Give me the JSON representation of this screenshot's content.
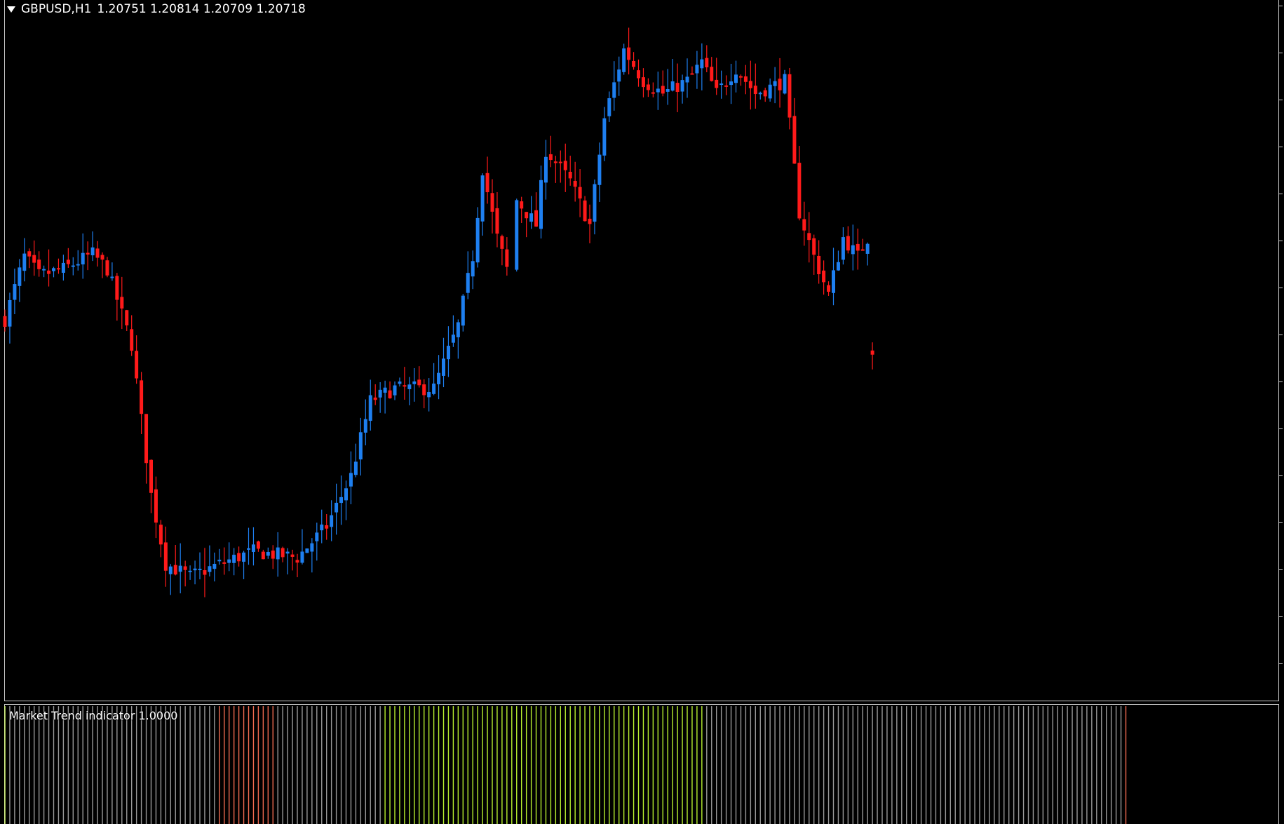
{
  "chart": {
    "symbol_timeframe": "GBPUSD,H1",
    "quote": "1.20751 1.20814 1.20709 1.20718",
    "bull_color": "#1e7ff0",
    "bear_color": "#ff1a1a",
    "background": "#000000"
  },
  "indicator": {
    "label": "Market Trend indicator 1.0000",
    "colors": {
      "neutral": "#9a9a9a",
      "down": "#f06a50",
      "up": "#b8f030",
      "lime": "#d8ff70"
    },
    "bars": "LNNNNNNNNNNNNNNNNNNNNNNNNNNNNNNNNNNNNNNNNNNNDDDDDDDDDDDDNNNNNNNNNNNNNNNNNNNNNNUUUUUUUUUUUUUUUUUUUUUUUUUUUUUUUUUUUUUUUUUUUUUUUUUUUUUUUUUUUUUUUUUUNNNNNNNNNNNNNNNNNNNNNNNNNNNNNNNNNNNNNNNNNNNNNNNNNNNNNNNNNNNNNNNNNNNNNNNNNNNNNNNNNNNNNND"
  },
  "chart_data": {
    "type": "candlestick",
    "symbol": "GBPUSD",
    "timeframe": "H1",
    "ylim": [
      1.18,
      1.235
    ],
    "last_bar": {
      "open": 1.20751,
      "high": 1.20814,
      "low": 1.20709,
      "close": 1.20718
    },
    "close_path_anchors": [
      [
        0,
        1.21
      ],
      [
        4,
        1.215
      ],
      [
        7,
        1.2135
      ],
      [
        12,
        1.214
      ],
      [
        18,
        1.2152
      ],
      [
        21,
        1.214
      ],
      [
        26,
        1.208
      ],
      [
        30,
        1.196
      ],
      [
        33,
        1.1905
      ],
      [
        38,
        1.1895
      ],
      [
        44,
        1.1905
      ],
      [
        51,
        1.1915
      ],
      [
        60,
        1.191
      ],
      [
        66,
        1.1935
      ],
      [
        71,
        1.1975
      ],
      [
        75,
        1.2035
      ],
      [
        80,
        1.2045
      ],
      [
        88,
        1.2045
      ],
      [
        93,
        1.2095
      ],
      [
        96,
        1.215
      ],
      [
        98,
        1.222
      ],
      [
        101,
        1.2165
      ],
      [
        103,
        1.214
      ],
      [
        104,
        1.214
      ],
      [
        105,
        1.2195
      ],
      [
        109,
        1.2175
      ],
      [
        111,
        1.2235
      ],
      [
        116,
        1.221
      ],
      [
        120,
        1.2175
      ],
      [
        123,
        1.226
      ],
      [
        127,
        1.2315
      ],
      [
        131,
        1.229
      ],
      [
        135,
        1.228
      ],
      [
        140,
        1.229
      ],
      [
        143,
        1.2305
      ],
      [
        146,
        1.228
      ],
      [
        150,
        1.23
      ],
      [
        154,
        1.228
      ],
      [
        160,
        1.229
      ],
      [
        163,
        1.2185
      ],
      [
        166,
        1.215
      ],
      [
        169,
        1.212
      ],
      [
        172,
        1.2165
      ],
      [
        175,
        1.215
      ],
      [
        178,
        1.2172
      ]
    ],
    "gaps_at_bar": [
      104
    ]
  }
}
